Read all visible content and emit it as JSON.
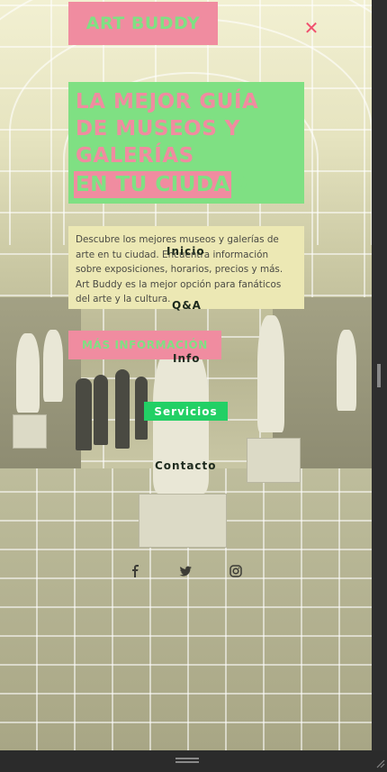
{
  "brand": {
    "logo": "ART BUDDY"
  },
  "close_icon": "close-icon",
  "hero": {
    "line1": "LA MEJOR GUÍA",
    "line2": "DE MUSEOS Y",
    "line3": "GALERÍAS",
    "line4": "EN TU CIUDAD"
  },
  "description": "Descubre los mejores museos y galerías de arte en tu ciudad. Encuentra información sobre exposiciones, horarios, precios y más. Art Buddy es la mejor opción para fanáticos del arte y la cultura.",
  "cta": {
    "label": "MÁS INFORMACIÓN"
  },
  "nav": {
    "items": [
      {
        "label": "Inicio"
      },
      {
        "label": "Q&A"
      },
      {
        "label": "Info"
      },
      {
        "label": "Servicios"
      },
      {
        "label": "Contacto"
      }
    ]
  },
  "social": {
    "icons": [
      "facebook-icon",
      "twitter-icon",
      "instagram-icon"
    ]
  },
  "colors": {
    "pink": "#f08ca0",
    "green": "#7fe083",
    "active_nav": "#22d065",
    "close": "#f0506e"
  }
}
